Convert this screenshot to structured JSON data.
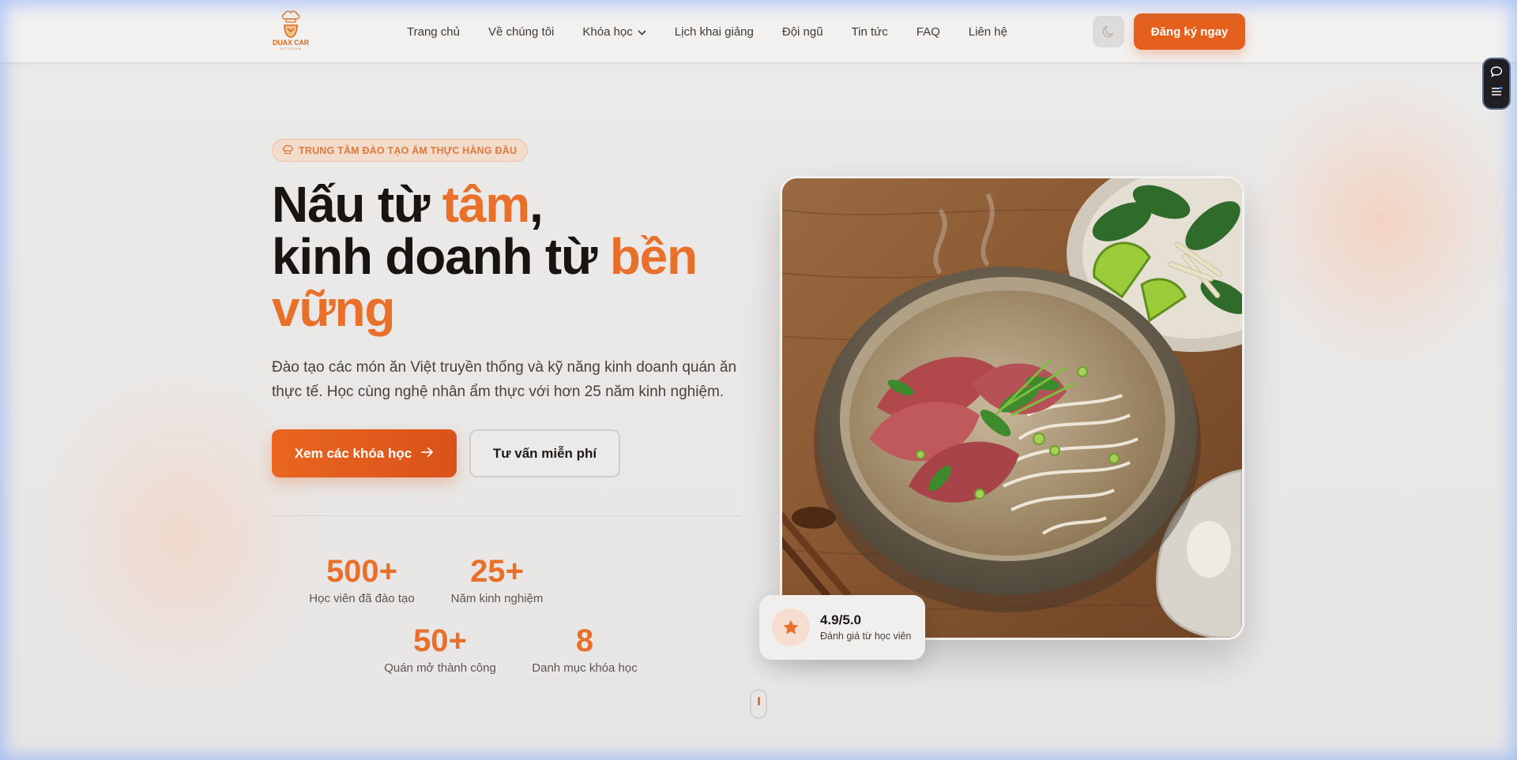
{
  "header": {
    "logo": {
      "text": "DUAX CAR",
      "sub": "KITCHEN"
    },
    "nav": [
      {
        "label": "Trang chủ"
      },
      {
        "label": "Về chúng tôi"
      },
      {
        "label": "Khóa học",
        "has_dropdown": true
      },
      {
        "label": "Lịch khai giảng"
      },
      {
        "label": "Đội ngũ"
      },
      {
        "label": "Tin tức"
      },
      {
        "label": "FAQ"
      },
      {
        "label": "Liên hệ"
      }
    ],
    "theme_toggle_icon": "moon-icon",
    "cta_label": "Đăng ký ngay"
  },
  "side_widget": {
    "icons": [
      "chat-icon",
      "menu-list-icon"
    ]
  },
  "hero": {
    "badge": "TRUNG TÂM ĐÀO TẠO ẨM THỰC HÀNG ĐẦU",
    "headline": {
      "p1": "Nấu từ ",
      "p1_accent": "tâm",
      "p1_end": ",",
      "p2": "kinh doanh từ ",
      "p2_accent": "bền",
      "p3_accent": "vững"
    },
    "description": "Đào tạo các món ăn Việt truyền thống và kỹ năng kinh doanh quán ăn thực tế. Học cùng nghệ nhân ẩm thực với hơn 25 năm kinh nghiệm.",
    "primary_button": "Xem các khóa học",
    "secondary_button": "Tư vấn miễn phí",
    "stats": [
      {
        "value": "500+",
        "label": "Học viên đã đào tạo"
      },
      {
        "value": "25+",
        "label": "Năm kinh nghiệm"
      },
      {
        "value": "50+",
        "label": "Quán mở thành công"
      },
      {
        "value": "8",
        "label": "Danh mục khóa học"
      }
    ],
    "rating": {
      "score": "4.9/5.0",
      "caption": "Đánh giá từ học viên",
      "icon": "star-icon"
    }
  },
  "colors": {
    "accent": "#e8702a",
    "button": "#e4601c",
    "text": "#171412"
  }
}
